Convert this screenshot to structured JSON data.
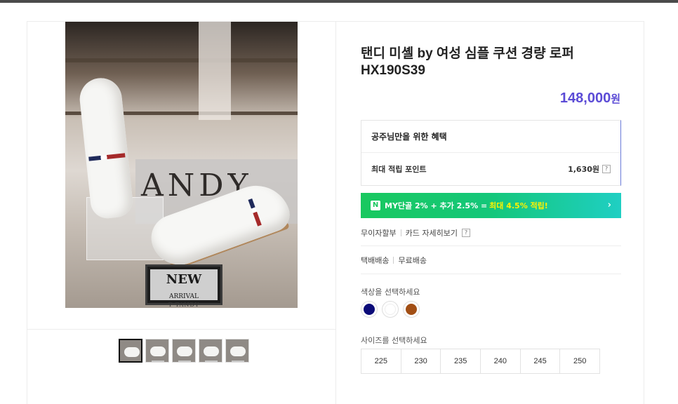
{
  "product": {
    "title_line1": "탠디 미셸 by 여성 심플 쿠션 경량 로퍼",
    "title_line2": "HX190S39",
    "price_value": "148,000",
    "price_unit": "원",
    "price_color": "#5b4bd6"
  },
  "photo": {
    "sign_text": "ANDY",
    "plaque_new": "NEW",
    "plaque_arrival": "ARRIVAL",
    "plaque_brand": "T TANDY"
  },
  "thumbnails": [
    {
      "active": true
    },
    {
      "active": false
    },
    {
      "active": false
    },
    {
      "active": false
    },
    {
      "active": false
    }
  ],
  "benefit": {
    "heading": "공주님만을 위한 혜택",
    "points_label": "최대 적립 포인트",
    "points_value": "1,630원",
    "help_icon": "?"
  },
  "npay": {
    "badge": "N",
    "text": "MY단골 2% + 추가 2.5% = ",
    "highlight": "최대 4.5% 적립!",
    "chevron": "›"
  },
  "payment": {
    "installment": "무이자할부",
    "card_detail": "카드 자세히보기"
  },
  "delivery": {
    "type": "택배배송",
    "fee": "무료배송"
  },
  "color_select": {
    "label": "색상을 선택하세요",
    "options": [
      "#0b0b78",
      "#ffffff",
      "#a24f15"
    ]
  },
  "size_select": {
    "label": "사이즈를 선택하세요",
    "options": [
      "225",
      "230",
      "235",
      "240",
      "245",
      "250"
    ]
  }
}
